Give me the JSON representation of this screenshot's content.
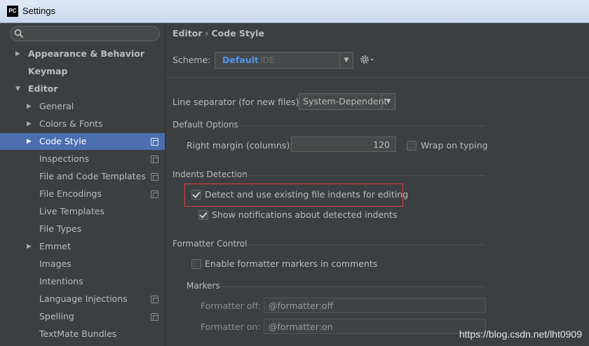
{
  "window": {
    "app_icon": "PC",
    "title": "Settings"
  },
  "search": {
    "placeholder": "",
    "value": "",
    "icon": "search-icon"
  },
  "sidebar": {
    "items": [
      {
        "label": "Appearance & Behavior",
        "indent": 0,
        "expand": "collapsed",
        "bold": true,
        "selected": false,
        "project": false
      },
      {
        "label": "Keymap",
        "indent": 0,
        "expand": "none",
        "bold": true,
        "selected": false,
        "project": false
      },
      {
        "label": "Editor",
        "indent": 0,
        "expand": "expanded",
        "bold": true,
        "selected": false,
        "project": false
      },
      {
        "label": "General",
        "indent": 1,
        "expand": "collapsed",
        "bold": false,
        "selected": false,
        "project": false
      },
      {
        "label": "Colors & Fonts",
        "indent": 1,
        "expand": "collapsed",
        "bold": false,
        "selected": false,
        "project": false
      },
      {
        "label": "Code Style",
        "indent": 1,
        "expand": "collapsed",
        "bold": false,
        "selected": true,
        "project": true
      },
      {
        "label": "Inspections",
        "indent": 1,
        "expand": "none",
        "bold": false,
        "selected": false,
        "project": true
      },
      {
        "label": "File and Code Templates",
        "indent": 1,
        "expand": "none",
        "bold": false,
        "selected": false,
        "project": true
      },
      {
        "label": "File Encodings",
        "indent": 1,
        "expand": "none",
        "bold": false,
        "selected": false,
        "project": true
      },
      {
        "label": "Live Templates",
        "indent": 1,
        "expand": "none",
        "bold": false,
        "selected": false,
        "project": false
      },
      {
        "label": "File Types",
        "indent": 1,
        "expand": "none",
        "bold": false,
        "selected": false,
        "project": false
      },
      {
        "label": "Emmet",
        "indent": 1,
        "expand": "collapsed",
        "bold": false,
        "selected": false,
        "project": false
      },
      {
        "label": "Images",
        "indent": 1,
        "expand": "none",
        "bold": false,
        "selected": false,
        "project": false
      },
      {
        "label": "Intentions",
        "indent": 1,
        "expand": "none",
        "bold": false,
        "selected": false,
        "project": false
      },
      {
        "label": "Language Injections",
        "indent": 1,
        "expand": "none",
        "bold": false,
        "selected": false,
        "project": true
      },
      {
        "label": "Spelling",
        "indent": 1,
        "expand": "none",
        "bold": false,
        "selected": false,
        "project": true
      },
      {
        "label": "TextMate Bundles",
        "indent": 1,
        "expand": "none",
        "bold": false,
        "selected": false,
        "project": false
      }
    ]
  },
  "breadcrumb": {
    "parent": "Editor",
    "separator": "›",
    "current": "Code Style"
  },
  "scheme": {
    "label": "Scheme:",
    "value": "Default",
    "tag": "IDE",
    "settings_icon": "gear-icon"
  },
  "line_separator": {
    "label": "Line separator (for new files):",
    "value": "System-Dependent"
  },
  "default_options": {
    "title": "Default Options",
    "right_margin_label": "Right margin (columns):",
    "right_margin_value": "120",
    "wrap_label": "Wrap on typing",
    "wrap_checked": false
  },
  "indents_detection": {
    "title": "Indents Detection",
    "detect_label": "Detect and use existing file indents for editing",
    "detect_checked": true,
    "notify_label": "Show notifications about detected indents",
    "notify_checked": true
  },
  "formatter_control": {
    "title": "Formatter Control",
    "enable_label": "Enable formatter markers in comments",
    "enable_checked": false,
    "markers_title": "Markers",
    "off_label": "Formatter off:",
    "off_value": "@formatter:off",
    "on_label": "Formatter on:",
    "on_value": "@formatter:on"
  },
  "watermark": "https://blog.csdn.net/lht0909",
  "colors": {
    "selection": "#4b6eaf",
    "scheme_value": "#5394ec",
    "highlight_box": "#d9403b",
    "background": "#3c3f41"
  }
}
